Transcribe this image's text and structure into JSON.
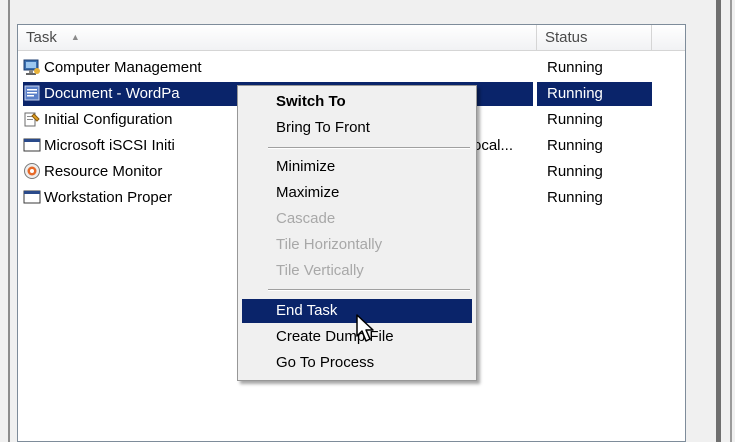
{
  "columns": {
    "task": "Task",
    "status": "Status"
  },
  "rows": [
    {
      "task": "Computer Management",
      "status": "Running",
      "icon": "computer-management-icon",
      "selected": false
    },
    {
      "task": "Document - WordPa",
      "status": "Running",
      "icon": "wordpad-icon",
      "selected": true
    },
    {
      "task": "Initial Configuration",
      "status": "Running",
      "icon": "initial-configuration-icon",
      "selected": false
    },
    {
      "task": "Microsoft iSCSI Initi",
      "task_tail": "ocal...",
      "status": "Running",
      "icon": "window-icon",
      "selected": false
    },
    {
      "task": "Resource Monitor",
      "status": "Running",
      "icon": "resource-monitor-icon",
      "selected": false
    },
    {
      "task": "Workstation Proper",
      "status": "Running",
      "icon": "window-icon",
      "selected": false
    }
  ],
  "context_menu": {
    "items": [
      {
        "label": "Switch To",
        "bold": true,
        "enabled": true
      },
      {
        "label": "Bring To Front",
        "enabled": true
      },
      {
        "label": "Minimize",
        "enabled": true
      },
      {
        "label": "Maximize",
        "enabled": true
      },
      {
        "label": "Cascade",
        "enabled": false
      },
      {
        "label": "Tile Horizontally",
        "enabled": false
      },
      {
        "label": "Tile Vertically",
        "enabled": false
      },
      {
        "label": "End Task",
        "enabled": true,
        "highlighted": true
      },
      {
        "label": "Create Dump File",
        "enabled": true
      },
      {
        "label": "Go To Process",
        "enabled": true
      }
    ]
  },
  "colors": {
    "selection": "#0a246a",
    "menu_background": "#f0f0f0",
    "disabled_text": "#a8a8a8"
  }
}
